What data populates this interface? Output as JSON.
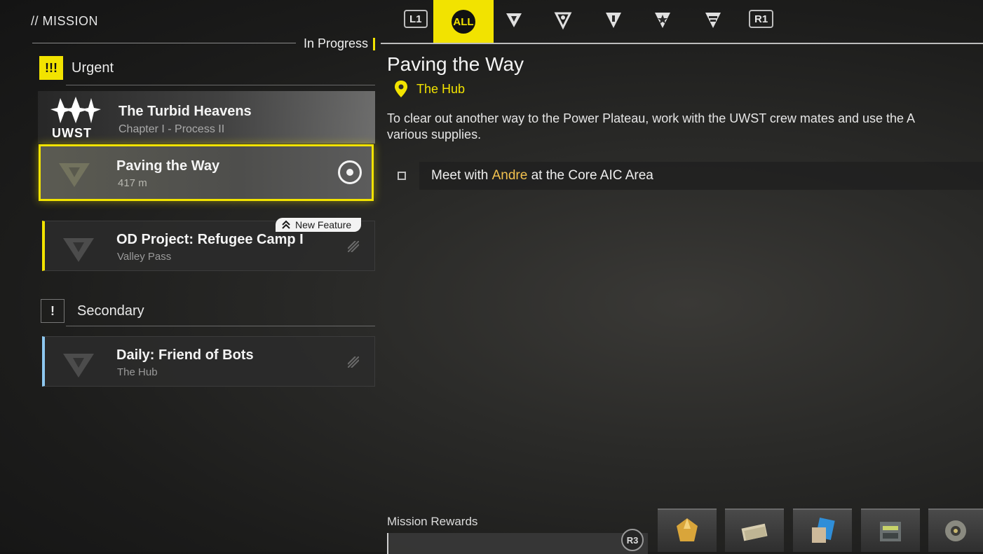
{
  "header": {
    "title": "// MISSION",
    "tabs": [
      {
        "label": "L1",
        "type": "key"
      },
      {
        "label": "ALL",
        "type": "filter-all",
        "selected": true
      },
      {
        "icon": "filter-icon-1"
      },
      {
        "icon": "filter-icon-2"
      },
      {
        "icon": "filter-icon-3"
      },
      {
        "icon": "filter-icon-4"
      },
      {
        "icon": "filter-icon-5"
      },
      {
        "label": "R1",
        "type": "key"
      }
    ],
    "status_label": "In Progress"
  },
  "list": {
    "urgent": {
      "icon_text": "!!!",
      "label": "Urgent",
      "chapter": {
        "logo_text": "UWST",
        "title": "The Turbid Heavens",
        "subtitle": "Chapter I - Process II"
      },
      "items": [
        {
          "title": "Paving the Way",
          "subtitle": "417 m",
          "selected": true,
          "tracked": true
        },
        {
          "title": "OD Project: Refugee Camp I",
          "subtitle": "Valley Pass",
          "badge": "New Feature"
        }
      ]
    },
    "secondary": {
      "icon_text": "!",
      "label": "Secondary",
      "items": [
        {
          "title": "Daily: Friend of Bots",
          "subtitle": "The Hub"
        }
      ]
    }
  },
  "detail": {
    "title": "Paving the Way",
    "location": "The Hub",
    "description_line1": "To clear out another way to the Power Plateau, work with the UWST crew mates and use the A",
    "description_line2": "various supplies.",
    "objective": {
      "prefix": "Meet with ",
      "highlight": "Andre",
      "suffix": " at the Core AIC Area"
    },
    "rewards_label": "Mission Rewards",
    "rewards_key": "R3",
    "rewards": [
      {
        "icon": "gold-crystal-icon"
      },
      {
        "icon": "cash-bundle-icon"
      },
      {
        "icon": "exp-card-icon"
      },
      {
        "icon": "component-box-icon"
      },
      {
        "icon": "gear-part-icon"
      }
    ]
  },
  "colors": {
    "accent": "#f2e300",
    "highlight": "#f2c14e",
    "secondary_accent": "#8ec8f0"
  }
}
